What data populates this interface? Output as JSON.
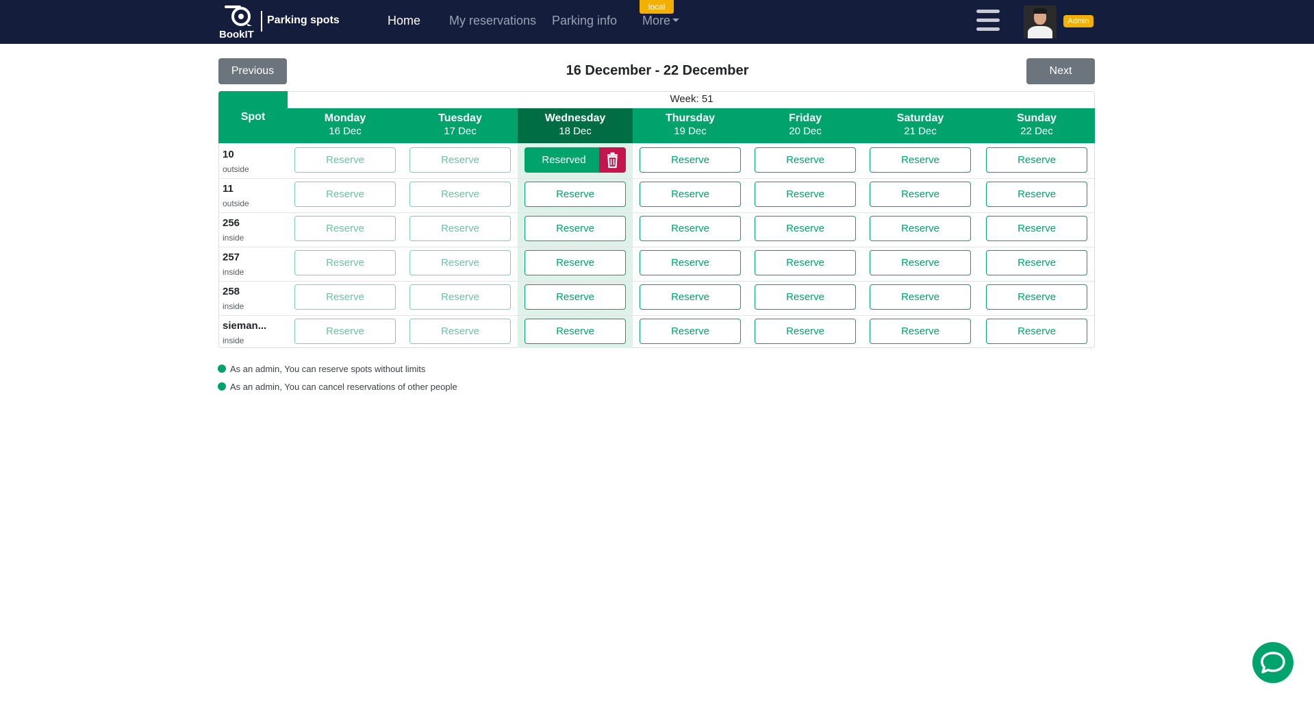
{
  "navbar": {
    "brand": "BookIT",
    "page_title": "Parking spots",
    "links": [
      {
        "label": "Home",
        "active": true
      },
      {
        "label": "My reservations",
        "active": false
      },
      {
        "label": "Parking info",
        "active": false
      },
      {
        "label": "More",
        "active": false
      }
    ],
    "env_badge": "local",
    "user_role": "Admin",
    "icons": [
      "bookit-logo-icon",
      "hamburger-menu-icon",
      "user-avatar"
    ]
  },
  "week_nav": {
    "prev_label": "Previous",
    "next_label": "Next",
    "range": "16 December - 22 December",
    "week_label": "Week: 51"
  },
  "table": {
    "spot_header": "Spot",
    "days": [
      {
        "name": "Monday",
        "date": "16 Dec"
      },
      {
        "name": "Tuesday",
        "date": "17 Dec"
      },
      {
        "name": "Wednesday",
        "date": "18 Dec",
        "today": true
      },
      {
        "name": "Thursday",
        "date": "19 Dec"
      },
      {
        "name": "Friday",
        "date": "20 Dec"
      },
      {
        "name": "Saturday",
        "date": "21 Dec"
      },
      {
        "name": "Sunday",
        "date": "22 Dec"
      }
    ],
    "reserve_label": "Reserve",
    "reserved_label": "Reserved",
    "spots": [
      {
        "number": "10",
        "location": "outside"
      },
      {
        "number": "11",
        "location": "outside"
      },
      {
        "number": "256",
        "location": "inside"
      },
      {
        "number": "257",
        "location": "inside"
      },
      {
        "number": "258",
        "location": "inside"
      },
      {
        "number": "sieman...",
        "location": "inside"
      }
    ],
    "past_days_disabled": [
      "Monday",
      "Tuesday"
    ],
    "reserved_cell": {
      "spot": "10",
      "day": "Wednesday"
    }
  },
  "notes": [
    "As an admin, You can reserve spots without limits",
    "As an admin, You can cancel reservations of other people"
  ],
  "colors": {
    "navbar": "#141d3b",
    "primary_green": "#00a36c",
    "today_green": "#006d45",
    "delete_red": "#c4154f",
    "badge_yellow": "#f4b000",
    "gray_button": "#6c757d"
  }
}
